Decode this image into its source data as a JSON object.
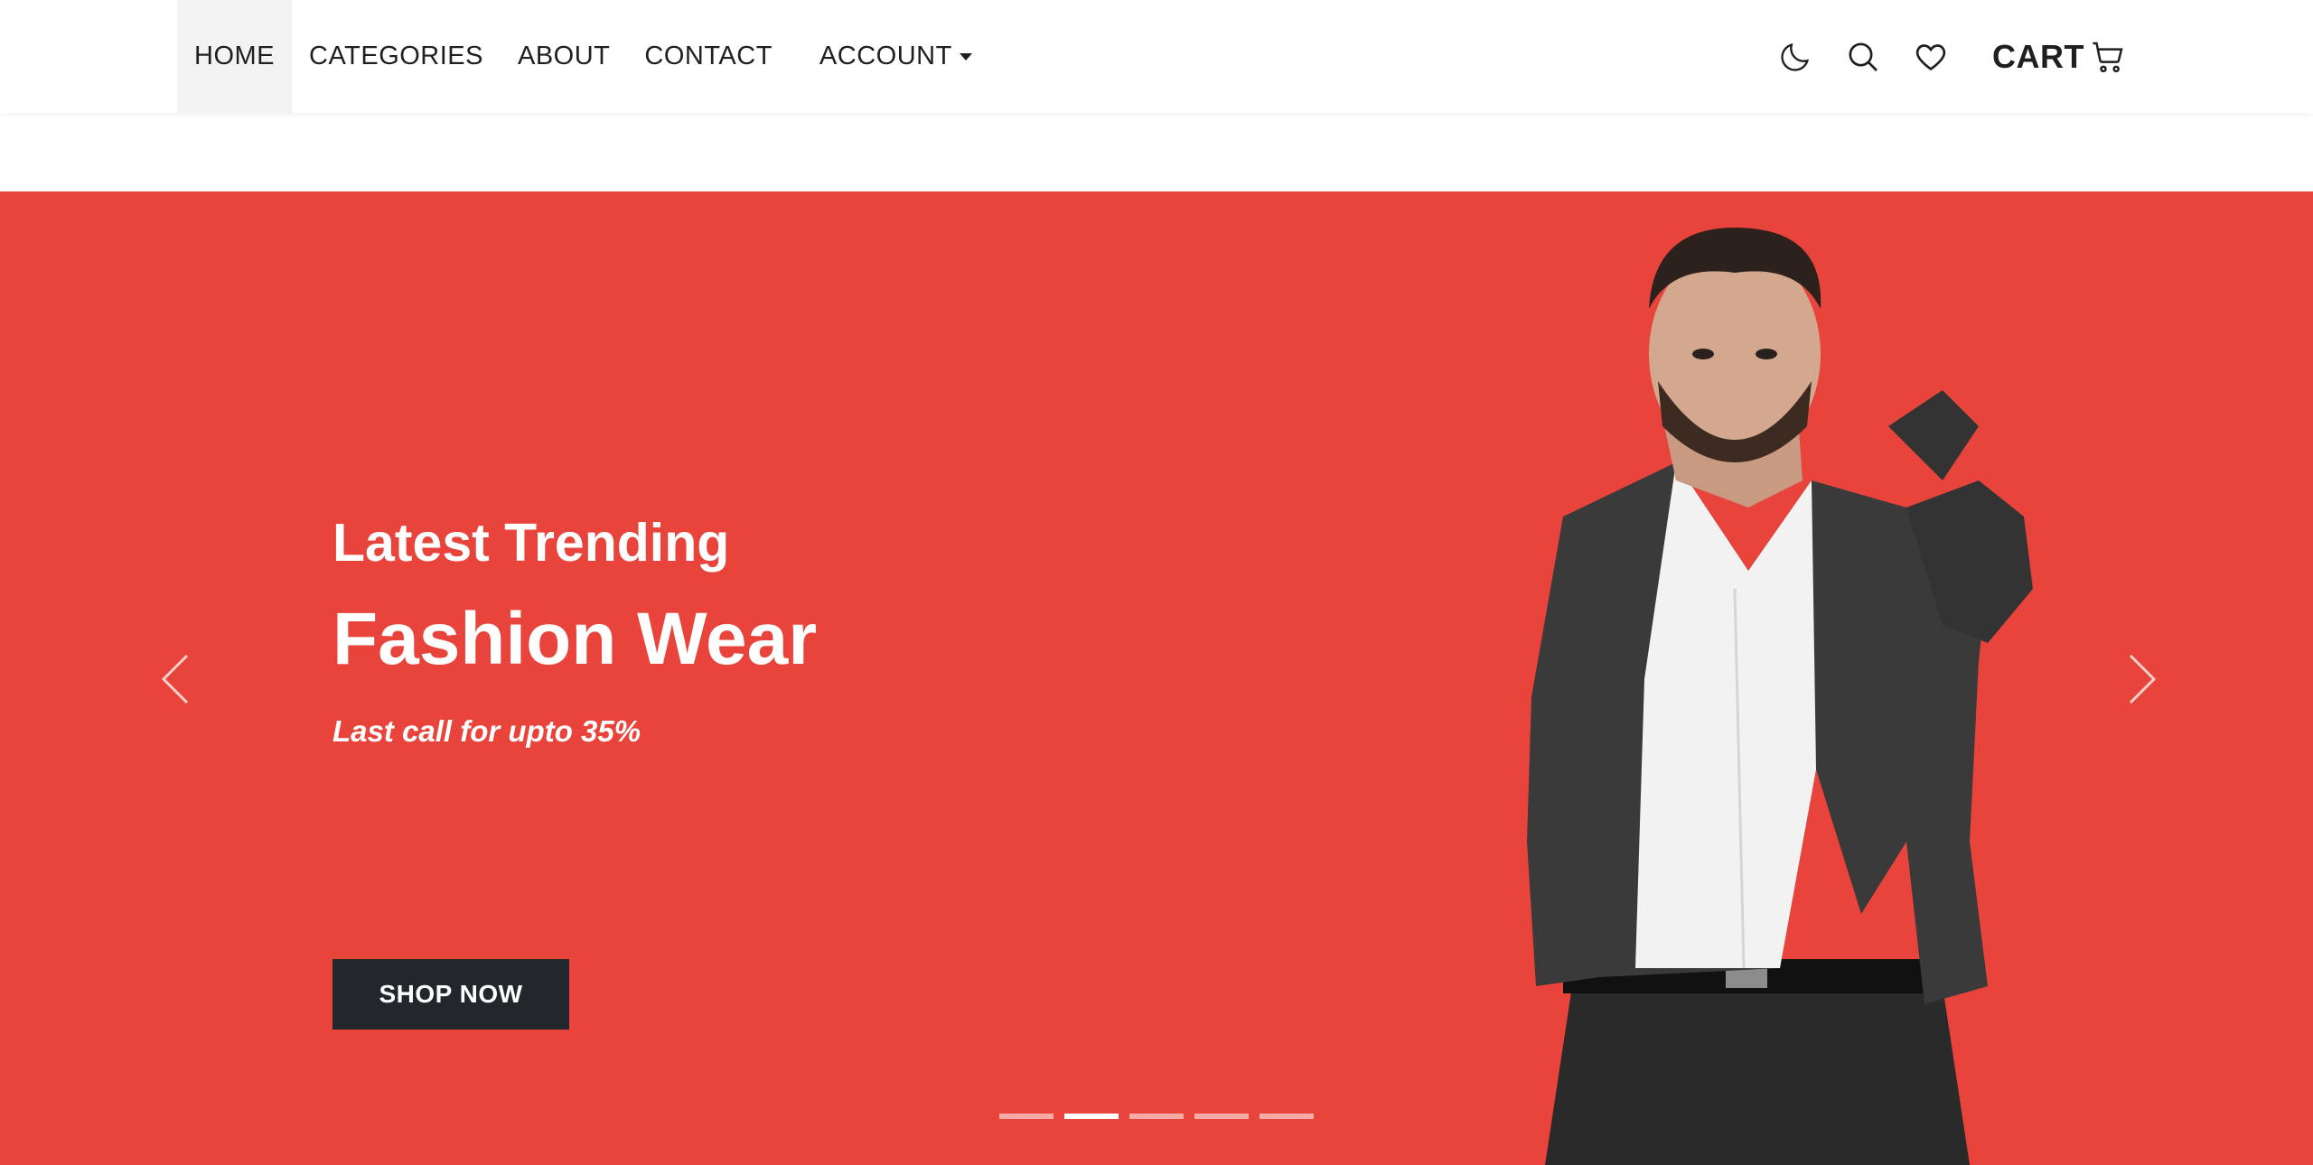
{
  "nav": {
    "items": [
      {
        "label": "HOME",
        "active": true
      },
      {
        "label": "CATEGORIES"
      },
      {
        "label": "ABOUT"
      },
      {
        "label": "CONTACT"
      }
    ],
    "account_label": "ACCOUNT",
    "icons": [
      "moon-icon",
      "search-icon",
      "heart-icon",
      "cart-icon"
    ],
    "cart_label": "CART"
  },
  "hero": {
    "subtitle": "Latest Trending",
    "title": "Fashion Wear",
    "tagline": "Last call for upto 35%",
    "button_label": "SHOP NOW",
    "background_color": "#e9443b",
    "button_color": "#22272b",
    "slide_count": 5,
    "active_slide": 2
  }
}
